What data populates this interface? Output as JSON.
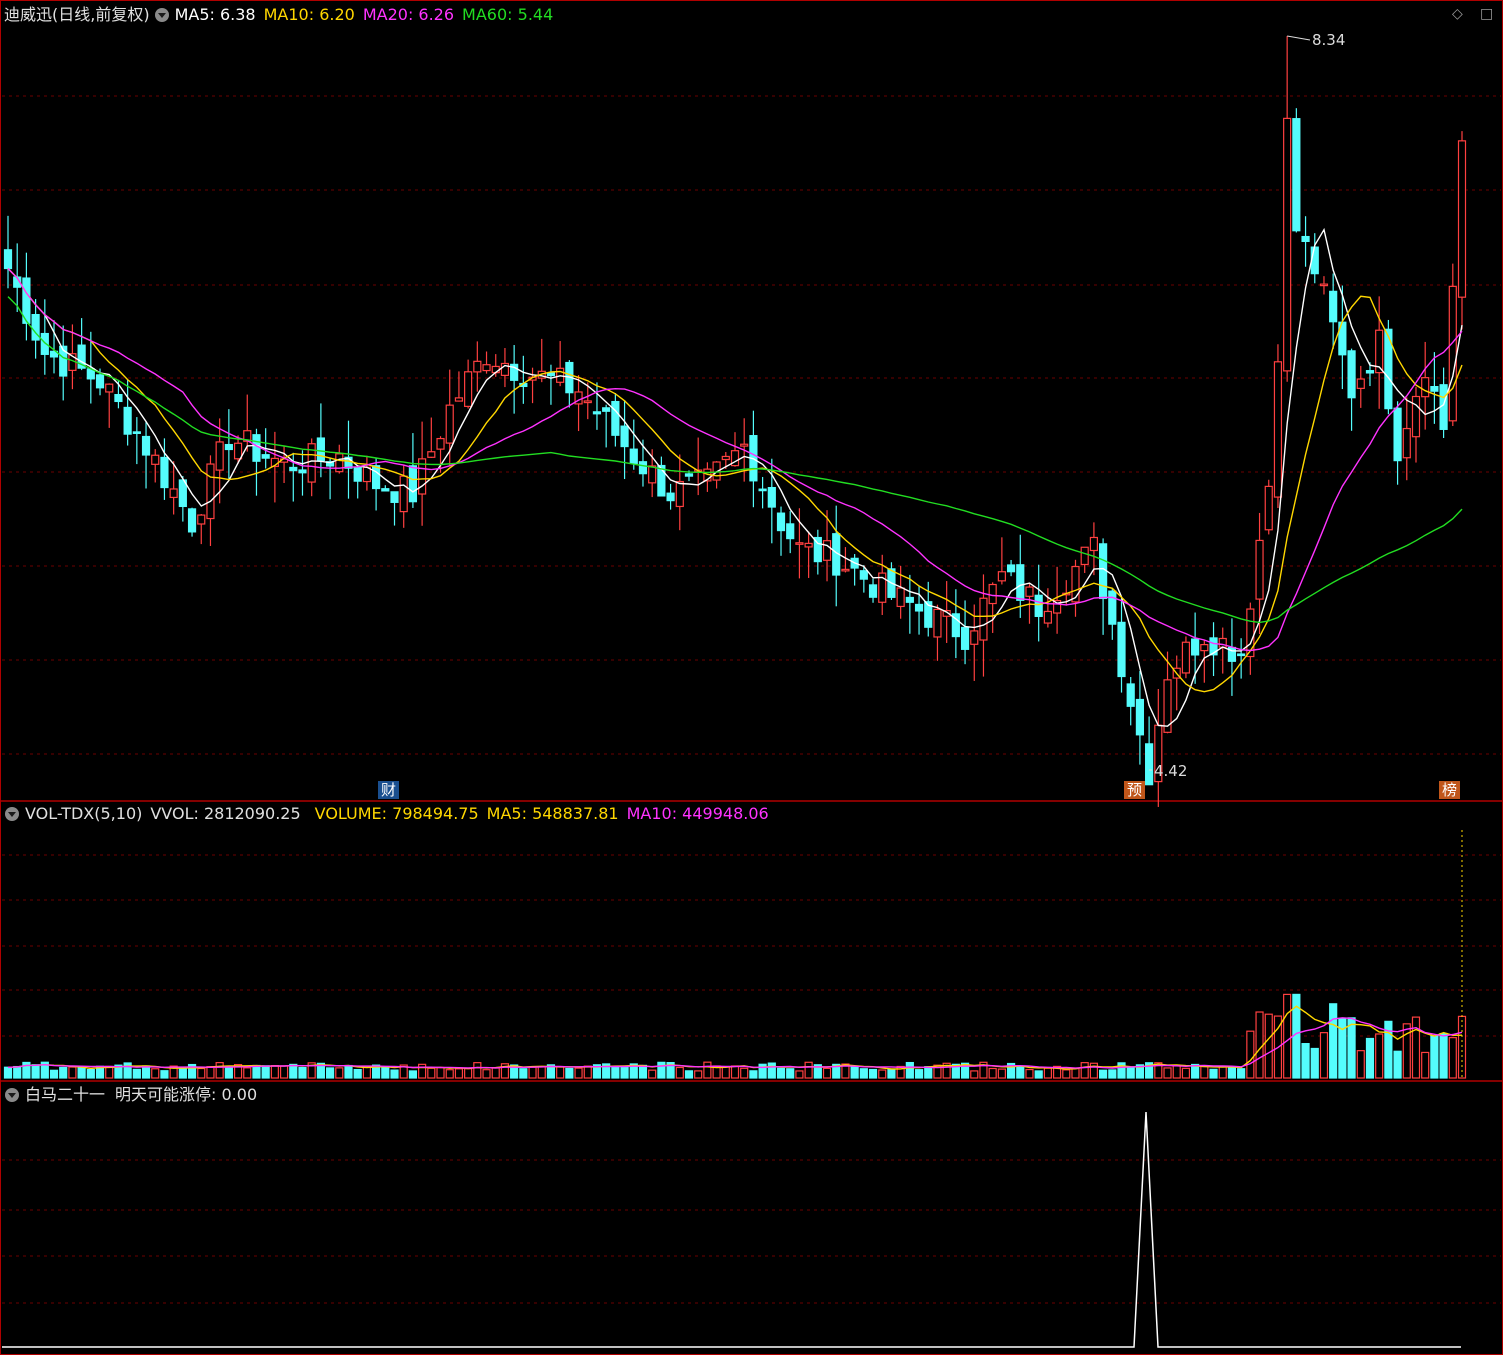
{
  "main_panel": {
    "title": "迪威迅(日线,前复权)",
    "indicators": [
      {
        "label": "MA5: 6.38",
        "color": "#ffffff"
      },
      {
        "label": "MA10: 6.20",
        "color": "#ffd700"
      },
      {
        "label": "MA20: 6.26",
        "color": "#ff33ff"
      },
      {
        "label": "MA60: 5.44",
        "color": "#22dd22"
      }
    ],
    "high_label": "8.34",
    "low_label": "4.42",
    "flags": {
      "cai": "财",
      "yu": "预",
      "bang": "榜"
    }
  },
  "volume_panel": {
    "title": "VOL-TDX(5,10)",
    "indicators": [
      {
        "label": "VVOL: 2812090.25",
        "color": "#e0e0e0"
      },
      {
        "label": "VOLUME: 798494.75",
        "color": "#ffd700"
      },
      {
        "label": "MA5: 548837.81",
        "color": "#ffd700"
      },
      {
        "label": "MA10: 449948.06",
        "color": "#ff33ff"
      }
    ]
  },
  "signal_panel": {
    "title": "白马二十一",
    "indicators": [
      {
        "label": "明天可能涨停: 0.00",
        "color": "#e0e0e0"
      }
    ]
  },
  "colors": {
    "up": "#ff4040",
    "down": "#54fcfc",
    "grid": "#6b0000",
    "divider": "#b00000",
    "ma5": "#ffffff",
    "ma10": "#ffd700",
    "ma20": "#ff33ff",
    "ma60": "#22dd22"
  },
  "chart_data": {
    "type": "candlestick",
    "price_high": 8.34,
    "price_low": 4.42,
    "ma60_end": 5.44,
    "ma5_end": 6.38,
    "ma10_end": 6.2,
    "ma20_end": 6.26,
    "last_volume": 798494.75,
    "vol_ma5_end": 548837.81,
    "vol_ma10_end": 449948.06,
    "signal_value_end": 0.0
  }
}
